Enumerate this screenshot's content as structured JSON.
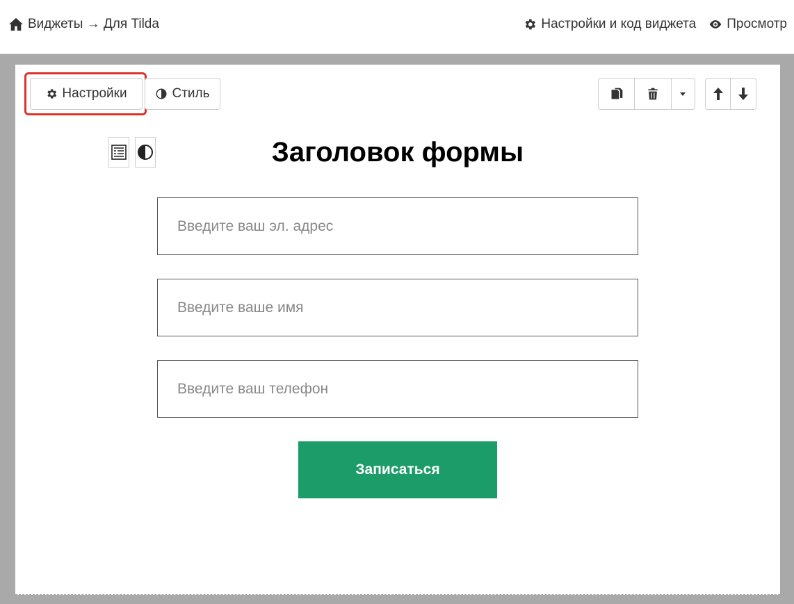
{
  "breadcrumb": {
    "home_icon": "home-icon",
    "text": "Виджеты → Для Tilda"
  },
  "topnav": {
    "settings_label": "Настройки и код виджета",
    "settings_icon": "gear-icon",
    "preview_label": "Просмотр",
    "preview_icon": "eye-icon"
  },
  "toolbar": {
    "settings_label": "Настройки",
    "settings_icon": "gear-icon",
    "style_label": "Стиль",
    "style_icon": "contrast-icon",
    "copy_icon": "copy-icon",
    "delete_icon": "trash-icon",
    "more_icon": "caret-down-icon",
    "move_up_icon": "arrow-up-icon",
    "move_down_icon": "arrow-down-icon",
    "highlight_color": "#d9342b"
  },
  "form": {
    "title": "Заголовок формы",
    "email_placeholder": "Введите ваш эл. адрес",
    "name_placeholder": "Введите ваше имя",
    "phone_placeholder": "Введите ваш телефон",
    "submit_label": "Записаться",
    "submit_color": "#1b9c68"
  }
}
